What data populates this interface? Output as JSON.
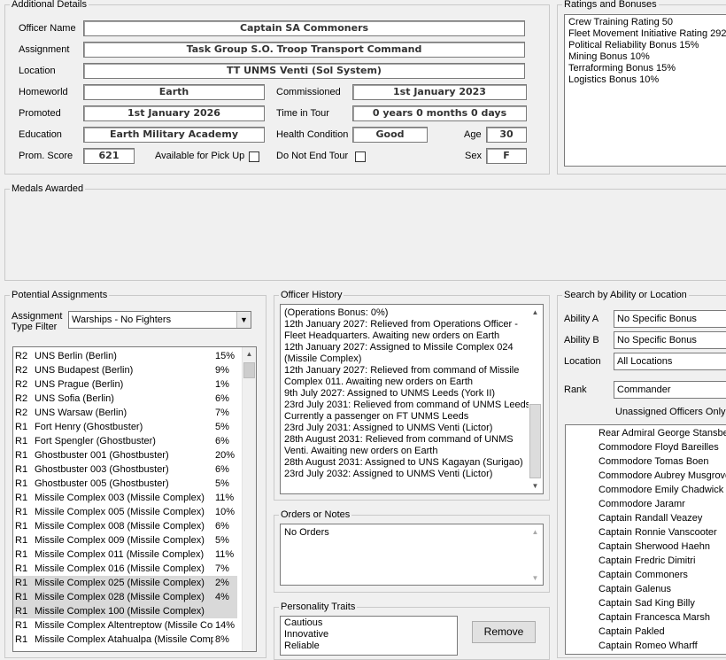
{
  "additional_details": {
    "title": "Additional Details",
    "officer_name_label": "Officer Name",
    "officer_name": "Captain SA Commoners",
    "assignment_label": "Assignment",
    "assignment": "Task Group S.O. Troop Transport Command",
    "location_label": "Location",
    "location": "TT UNMS Venti (Sol System)",
    "homeworld_label": "Homeworld",
    "homeworld": "Earth",
    "commissioned_label": "Commissioned",
    "commissioned": "1st January 2023",
    "promoted_label": "Promoted",
    "promoted": "1st January 2026",
    "time_in_tour_label": "Time in Tour",
    "time_in_tour": "0 years 0 months 0 days",
    "education_label": "Education",
    "education": "Earth Military Academy",
    "health_label": "Health Condition",
    "health": "Good",
    "age_label": "Age",
    "age": "30",
    "prom_score_label": "Prom. Score",
    "prom_score": "621",
    "available_label": "Available for Pick Up",
    "do_not_end_tour_label": "Do Not End Tour",
    "sex_label": "Sex",
    "sex": "F"
  },
  "ratings": {
    "title": "Ratings and Bonuses",
    "items": [
      "Crew Training Rating 50",
      "Fleet Movement Initiative Rating 292",
      "Political Reliability Bonus 15%",
      "Mining Bonus 10%",
      "Terraforming Bonus 15%",
      "Logistics Bonus 10%"
    ]
  },
  "medals": {
    "title": "Medals Awarded"
  },
  "potential_assignments": {
    "title": "Potential Assignments",
    "filter_label_1": "Assignment",
    "filter_label_2": "Type Filter",
    "filter_value": "Warships - No Fighters",
    "rows": [
      {
        "rank": "R2",
        "name": "UNS Berlin (Berlin)",
        "pct": "15%"
      },
      {
        "rank": "R2",
        "name": "UNS Budapest (Berlin)",
        "pct": "9%"
      },
      {
        "rank": "R2",
        "name": "UNS Prague (Berlin)",
        "pct": "1%"
      },
      {
        "rank": "R2",
        "name": "UNS Sofia (Berlin)",
        "pct": "6%"
      },
      {
        "rank": "R2",
        "name": "UNS Warsaw (Berlin)",
        "pct": "7%"
      },
      {
        "rank": "R1",
        "name": "Fort Henry (Ghostbuster)",
        "pct": "5%"
      },
      {
        "rank": "R1",
        "name": "Fort Spengler (Ghostbuster)",
        "pct": "6%"
      },
      {
        "rank": "R1",
        "name": "Ghostbuster 001 (Ghostbuster)",
        "pct": "20%"
      },
      {
        "rank": "R1",
        "name": "Ghostbuster 003 (Ghostbuster)",
        "pct": "6%"
      },
      {
        "rank": "R1",
        "name": "Ghostbuster 005 (Ghostbuster)",
        "pct": "5%"
      },
      {
        "rank": "R1",
        "name": "Missile Complex 003 (Missile Complex)",
        "pct": "11%"
      },
      {
        "rank": "R1",
        "name": "Missile Complex 005 (Missile Complex)",
        "pct": "10%"
      },
      {
        "rank": "R1",
        "name": "Missile Complex 008 (Missile Complex)",
        "pct": "6%"
      },
      {
        "rank": "R1",
        "name": "Missile Complex 009 (Missile Complex)",
        "pct": "5%"
      },
      {
        "rank": "R1",
        "name": "Missile Complex 011 (Missile Complex)",
        "pct": "11%"
      },
      {
        "rank": "R1",
        "name": "Missile Complex 016 (Missile Complex)",
        "pct": "7%"
      },
      {
        "rank": "R1",
        "name": "Missile Complex 025 (Missile Complex)",
        "pct": "2%"
      },
      {
        "rank": "R1",
        "name": "Missile Complex 028 (Missile Complex)",
        "pct": "4%"
      },
      {
        "rank": "R1",
        "name": "Missile Complex 100 (Missile Complex)",
        "pct": ""
      },
      {
        "rank": "R1",
        "name": "Missile Complex Altentreptow (Missile Complex)",
        "pct": "14%"
      },
      {
        "rank": "R1",
        "name": "Missile Complex Atahualpa (Missile Complex)",
        "pct": "8%"
      }
    ]
  },
  "officer_history": {
    "title": "Officer History",
    "lines": [
      "(Operations Bonus: 0%)",
      "12th January 2027: Relieved from Operations Officer -",
      "Fleet Headquarters. Awaiting new orders on Earth",
      "12th January 2027: Assigned to Missile Complex 024",
      "(Missile Complex)",
      "12th January 2027: Relieved from command of Missile",
      "Complex 011. Awaiting new orders on Earth",
      "9th July 2027: Assigned to UNMS Leeds (York II)",
      "23rd July 2031: Relieved from command of UNMS Leeds.",
      "Currently a passenger on FT UNMS Leeds",
      "23rd July 2031: Assigned to UNMS Venti (Lictor)",
      "28th August 2031: Relieved from command of UNMS",
      "Venti. Awaiting new orders on Earth",
      "28th August 2031: Assigned to UNS Kagayan (Surigao)",
      "23rd July 2032: Assigned to UNMS Venti (Lictor)"
    ]
  },
  "orders": {
    "title": "Orders or Notes",
    "text": "No Orders"
  },
  "personality": {
    "title": "Personality Traits",
    "traits": [
      "Cautious",
      "Innovative",
      "Reliable"
    ],
    "remove_label": "Remove"
  },
  "search": {
    "title": "Search by Ability or Location",
    "ability_a_label": "Ability A",
    "ability_a": "No Specific Bonus",
    "ability_b_label": "Ability B",
    "ability_b": "No Specific Bonus",
    "location_label": "Location",
    "location": "All Locations",
    "rank_label": "Rank",
    "rank": "Commander",
    "unassigned_label": "Unassigned Officers Only",
    "officers": [
      "Rear Admiral George Stansbery",
      "Commodore Floyd Bareilles",
      "Commodore Tomas Boen",
      "Commodore Aubrey Musgrove",
      "Commodore Emily Chadwick",
      "Commodore Jaramr",
      "Captain Randall Veazey",
      "Captain Ronnie Vanscooter",
      "Captain Sherwood Haehn",
      "Captain Fredric Dimitri",
      "Captain Commoners",
      "Captain Galenus",
      "Captain Sad King Billy",
      "Captain Francesca Marsh",
      "Captain Pakled",
      "Captain Romeo Wharff"
    ]
  }
}
